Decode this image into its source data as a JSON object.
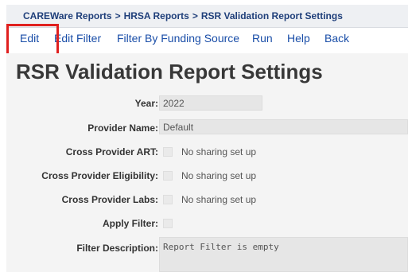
{
  "breadcrumb": {
    "items": [
      "CAREWare Reports",
      "HRSA Reports",
      "RSR Validation Report Settings"
    ],
    "separator": ">"
  },
  "menu": {
    "items": [
      "Edit",
      "Edit Filter",
      "Filter By Funding Source",
      "Run",
      "Help",
      "Back"
    ]
  },
  "page": {
    "title": "RSR Validation Report Settings"
  },
  "form": {
    "year_label": "Year:",
    "year_value": "2022",
    "provider_label": "Provider Name:",
    "provider_value": "Default",
    "cross_art_label": "Cross Provider ART:",
    "cross_art_text": "No sharing set up",
    "cross_elig_label": "Cross Provider Eligibility:",
    "cross_elig_text": "No sharing set up",
    "cross_labs_label": "Cross Provider Labs:",
    "cross_labs_text": "No sharing set up",
    "apply_filter_label": "Apply Filter:",
    "filter_desc_label": "Filter Description:",
    "filter_desc_value": "Report Filter is empty"
  },
  "colors": {
    "link": "#1a4ea8",
    "breadcrumb": "#1f3f7a",
    "highlight": "#e0201f",
    "content_bg": "#f4f4f4"
  }
}
